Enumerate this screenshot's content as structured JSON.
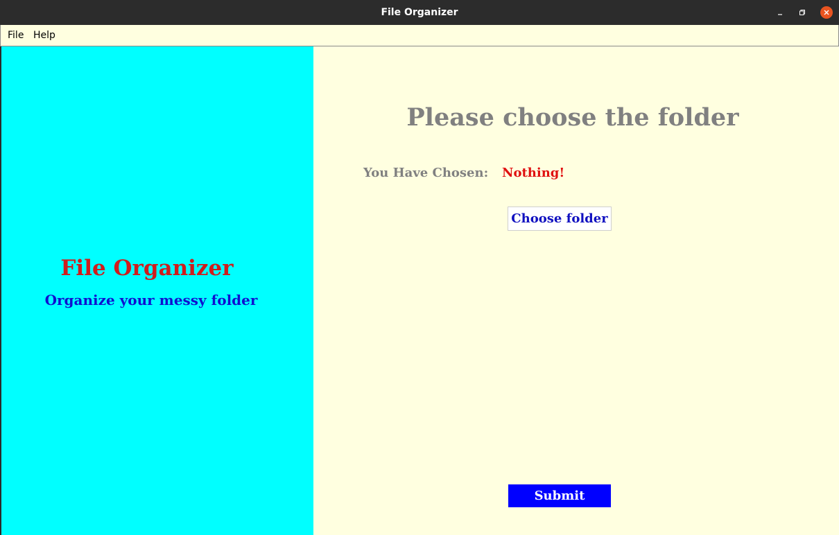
{
  "window": {
    "title": "File Organizer"
  },
  "menubar": {
    "items": [
      {
        "label": "File"
      },
      {
        "label": "Help"
      }
    ]
  },
  "left_panel": {
    "app_name": "File Organizer",
    "tagline": "Organize your messy folder"
  },
  "main": {
    "heading": "Please choose the folder",
    "chosen_label": "You Have Chosen:",
    "chosen_value": "Nothing!",
    "choose_button": "Choose folder",
    "submit_button": "Submit"
  },
  "colors": {
    "titlebar": "#2c2c2c",
    "close_button": "#e95420",
    "left_panel_bg": "#00ffff",
    "right_panel_bg": "#ffffe0",
    "app_name": "#d01c1c",
    "tagline": "#1010d0",
    "heading": "#808080",
    "chosen_value": "#e01010",
    "submit_bg": "#0000ff"
  },
  "icons": {
    "minimize": "minimize-icon",
    "maximize": "maximize-icon",
    "close": "close-icon"
  }
}
